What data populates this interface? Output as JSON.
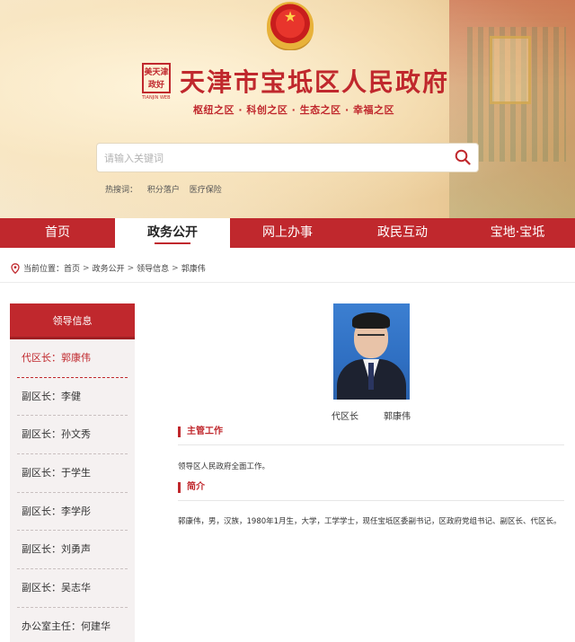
{
  "header": {
    "logo_text": "美天津政好",
    "logo_sub": "TIANJIN WEB",
    "site_title": "天津市宝坻区人民政府",
    "slogan": "枢纽之区 · 科创之区 · 生态之区 · 幸福之区",
    "search": {
      "placeholder": "请输入关键词"
    },
    "hot_label": "热搜词：",
    "hot_words": [
      "积分落户",
      "医疗保险"
    ]
  },
  "nav": {
    "items": [
      {
        "label": "首页"
      },
      {
        "label": "政务公开"
      },
      {
        "label": "网上办事"
      },
      {
        "label": "政民互动"
      },
      {
        "label": "宝地·宝坻"
      }
    ]
  },
  "breadcrumb": {
    "prefix": "当前位置：",
    "items": [
      "首页",
      "政务公开",
      "领导信息",
      "郭康伟"
    ]
  },
  "sidebar": {
    "title": "领导信息",
    "items": [
      {
        "label": "代区长：郭康伟"
      },
      {
        "label": "副区长：李健"
      },
      {
        "label": "副区长：孙文秀"
      },
      {
        "label": "副区长：于学生"
      },
      {
        "label": "副区长：李学彤"
      },
      {
        "label": "副区长：刘勇声"
      },
      {
        "label": "副区长：吴志华"
      },
      {
        "label": "办公室主任：何建华"
      }
    ]
  },
  "profile": {
    "position": "代区长",
    "name": "郭康伟",
    "duty_title": "主管工作",
    "duty_text": "领导区人民政府全面工作。",
    "bio_title": "简介",
    "bio_text": "郭康伟，男，汉族，1980年1月生，大学，工学学士，现任宝坻区委副书记，区政府党组书记、副区长、代区长。"
  },
  "colors": {
    "brand_red": "#c0282d",
    "banner_bg": "#f3dfba"
  }
}
